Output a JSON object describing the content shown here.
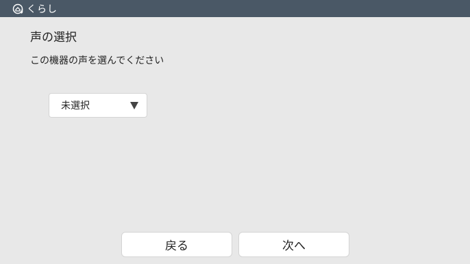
{
  "app": {
    "name": "くらし",
    "icon": "home-at-icon"
  },
  "page": {
    "title": "声の選択",
    "instruction": "この機器の声を選んでください"
  },
  "voice_select": {
    "selected_value": "未選択",
    "caret_icon": "caret-down-icon"
  },
  "footer": {
    "back_label": "戻る",
    "next_label": "次へ"
  }
}
